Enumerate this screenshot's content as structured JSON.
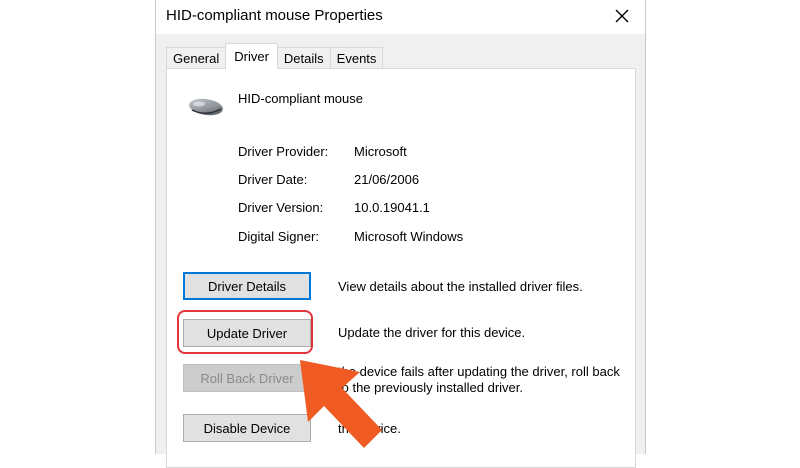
{
  "window": {
    "title": "HID-compliant mouse Properties",
    "close_icon": "close-icon"
  },
  "tabs": [
    {
      "label": "General",
      "active": false
    },
    {
      "label": "Driver",
      "active": true
    },
    {
      "label": "Details",
      "active": false
    },
    {
      "label": "Events",
      "active": false
    }
  ],
  "device": {
    "icon": "mouse-icon",
    "name": "HID-compliant mouse"
  },
  "info": [
    {
      "label": "Driver Provider:",
      "value": "Microsoft"
    },
    {
      "label": "Driver Date:",
      "value": "21/06/2006"
    },
    {
      "label": "Driver Version:",
      "value": "10.0.19041.1"
    },
    {
      "label": "Digital Signer:",
      "value": "Microsoft Windows"
    }
  ],
  "actions": [
    {
      "label": "Driver Details",
      "description": "View details about the installed driver files.",
      "enabled": true
    },
    {
      "label": "Update Driver",
      "description": "Update the driver for this device.",
      "enabled": true
    },
    {
      "label": "Roll Back Driver",
      "description": "the device fails after updating the driver, roll back to the previously installed driver.",
      "enabled": false
    },
    {
      "label": "Disable Device",
      "description": "the device.",
      "enabled": true
    }
  ],
  "annotation": {
    "highlight_color": "#e2343c",
    "arrow_color": "#f05a23",
    "arrow_icon": "arrow-up-left-icon"
  },
  "colors": {
    "focus_border": "#0078d7",
    "dialog_bg": "#f0f0f0"
  }
}
